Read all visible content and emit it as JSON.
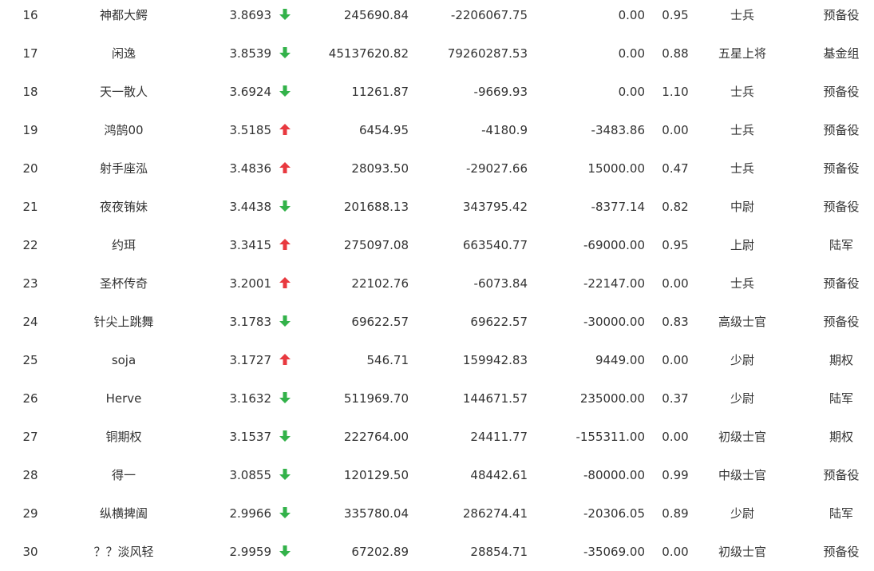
{
  "colors": {
    "up": "#e8393f",
    "down": "#33b24a"
  },
  "rows": [
    {
      "rank": "16",
      "name": "神都大鳄",
      "score": "3.8693",
      "trend": "down",
      "v1": "245690.84",
      "v2": "-2206067.75",
      "v3": "0.00",
      "ratio": "0.95",
      "title": "士兵",
      "group": "预备役"
    },
    {
      "rank": "17",
      "name": "闲逸",
      "score": "3.8539",
      "trend": "down",
      "v1": "45137620.82",
      "v2": "79260287.53",
      "v3": "0.00",
      "ratio": "0.88",
      "title": "五星上将",
      "group": "基金组"
    },
    {
      "rank": "18",
      "name": "天一散人",
      "score": "3.6924",
      "trend": "down",
      "v1": "11261.87",
      "v2": "-9669.93",
      "v3": "0.00",
      "ratio": "1.10",
      "title": "士兵",
      "group": "预备役"
    },
    {
      "rank": "19",
      "name": "鸿鹄00",
      "score": "3.5185",
      "trend": "up",
      "v1": "6454.95",
      "v2": "-4180.9",
      "v3": "-3483.86",
      "ratio": "0.00",
      "title": "士兵",
      "group": "预备役"
    },
    {
      "rank": "20",
      "name": "射手座泓",
      "score": "3.4836",
      "trend": "up",
      "v1": "28093.50",
      "v2": "-29027.66",
      "v3": "15000.00",
      "ratio": "0.47",
      "title": "士兵",
      "group": "预备役"
    },
    {
      "rank": "21",
      "name": "夜夜铕妹",
      "score": "3.4438",
      "trend": "down",
      "v1": "201688.13",
      "v2": "343795.42",
      "v3": "-8377.14",
      "ratio": "0.82",
      "title": "中尉",
      "group": "预备役"
    },
    {
      "rank": "22",
      "name": "约珥",
      "score": "3.3415",
      "trend": "up",
      "v1": "275097.08",
      "v2": "663540.77",
      "v3": "-69000.00",
      "ratio": "0.95",
      "title": "上尉",
      "group": "陆军"
    },
    {
      "rank": "23",
      "name": "圣杯传奇",
      "score": "3.2001",
      "trend": "up",
      "v1": "22102.76",
      "v2": "-6073.84",
      "v3": "-22147.00",
      "ratio": "0.00",
      "title": "士兵",
      "group": "预备役"
    },
    {
      "rank": "24",
      "name": "针尖上跳舞",
      "score": "3.1783",
      "trend": "down",
      "v1": "69622.57",
      "v2": "69622.57",
      "v3": "-30000.00",
      "ratio": "0.83",
      "title": "高级士官",
      "group": "预备役"
    },
    {
      "rank": "25",
      "name": "soja",
      "score": "3.1727",
      "trend": "up",
      "v1": "546.71",
      "v2": "159942.83",
      "v3": "9449.00",
      "ratio": "0.00",
      "title": "少尉",
      "group": "期权"
    },
    {
      "rank": "26",
      "name": "Herve",
      "score": "3.1632",
      "trend": "down",
      "v1": "511969.70",
      "v2": "144671.57",
      "v3": "235000.00",
      "ratio": "0.37",
      "title": "少尉",
      "group": "陆军"
    },
    {
      "rank": "27",
      "name": "铜期权",
      "score": "3.1537",
      "trend": "down",
      "v1": "222764.00",
      "v2": "24411.77",
      "v3": "-155311.00",
      "ratio": "0.00",
      "title": "初级士官",
      "group": "期权"
    },
    {
      "rank": "28",
      "name": "得一",
      "score": "3.0855",
      "trend": "down",
      "v1": "120129.50",
      "v2": "48442.61",
      "v3": "-80000.00",
      "ratio": "0.99",
      "title": "中级士官",
      "group": "预备役"
    },
    {
      "rank": "29",
      "name": "纵横捭阖",
      "score": "2.9966",
      "trend": "down",
      "v1": "335780.04",
      "v2": "286274.41",
      "v3": "-20306.05",
      "ratio": "0.89",
      "title": "少尉",
      "group": "陆军"
    },
    {
      "rank": "30",
      "name": "？？淡风轻",
      "score": "2.9959",
      "trend": "down",
      "v1": "67202.89",
      "v2": "28854.71",
      "v3": "-35069.00",
      "ratio": "0.00",
      "title": "初级士官",
      "group": "预备役"
    }
  ]
}
